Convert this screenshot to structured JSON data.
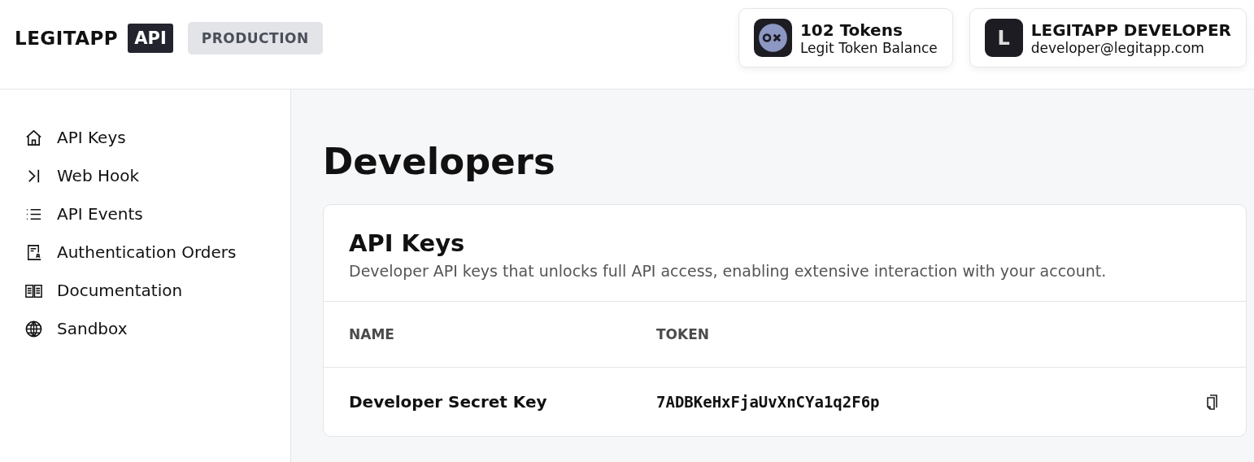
{
  "header": {
    "logo": "LEGITAPP",
    "logo_badge": "API",
    "environment": "PRODUCTION",
    "balance": {
      "title": "102 Tokens",
      "subtitle": "Legit Token Balance"
    },
    "account": {
      "initial": "L",
      "name": "LEGITAPP DEVELOPER",
      "email": "developer@legitapp.com"
    }
  },
  "sidebar": {
    "items": [
      {
        "label": "API Keys"
      },
      {
        "label": "Web Hook"
      },
      {
        "label": "API Events"
      },
      {
        "label": "Authentication Orders"
      },
      {
        "label": "Documentation"
      },
      {
        "label": "Sandbox"
      }
    ]
  },
  "page_title": "Developers",
  "card": {
    "title": "API Keys",
    "description": "Developer API keys that unlocks full API access, enabling extensive interaction with your account.",
    "table": {
      "columns": [
        "NAME",
        "TOKEN"
      ],
      "rows": [
        {
          "name": "Developer Secret Key",
          "token": "7ADBKeHxFjaUvXnCYa1q2F6p"
        }
      ]
    }
  }
}
